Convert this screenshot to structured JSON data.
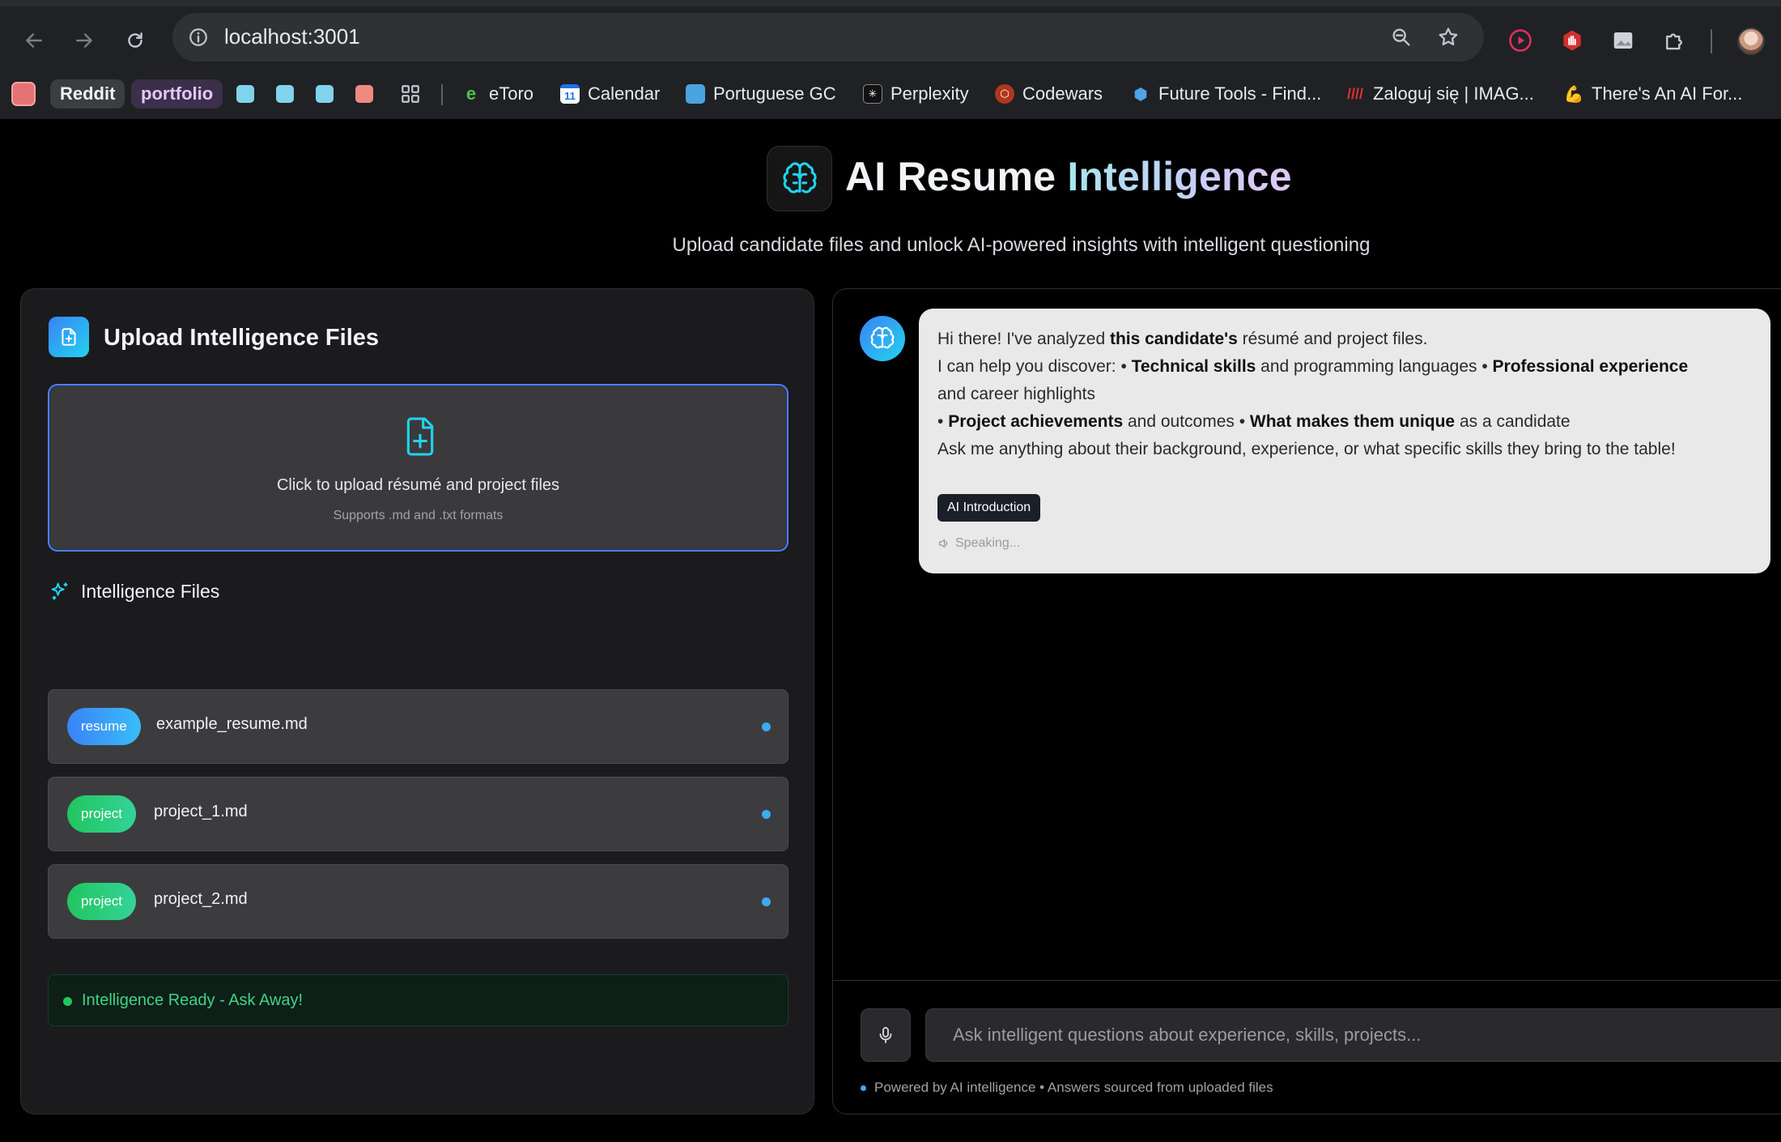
{
  "browser": {
    "url": "localhost:3001",
    "bookmarks": [
      {
        "label": "Reddit"
      },
      {
        "label": "portfolio"
      },
      {
        "label": "eToro"
      },
      {
        "label": "Calendar"
      },
      {
        "label": "Portuguese GC"
      },
      {
        "label": "Perplexity"
      },
      {
        "label": "Codewars"
      },
      {
        "label": "Future Tools - Find..."
      },
      {
        "label": "Zaloguj się | IMAG..."
      },
      {
        "label": "There's An AI For..."
      }
    ],
    "calendar_day": "11"
  },
  "hero": {
    "title_part1": "AI Resume",
    "title_part2": "Intelligence",
    "subtitle": "Upload candidate files and unlock AI-powered insights with intelligent questioning"
  },
  "upload": {
    "title": "Upload Intelligence Files",
    "dropzone_text": "Click to upload résumé and project files",
    "dropzone_sub": "Supports .md and .txt formats",
    "files_title": "Intelligence Files",
    "files": [
      {
        "tag": "resume",
        "name": "example_resume.md"
      },
      {
        "tag": "project",
        "name": "project_1.md"
      },
      {
        "tag": "project",
        "name": "project_2.md"
      }
    ],
    "status": "Intelligence Ready - Ask Away!"
  },
  "chat": {
    "message": {
      "l1a": "Hi there! I've analyzed ",
      "l1b": "this candidate's",
      "l1c": " résumé and project files.",
      "l2a": "I can help you discover: • ",
      "l2b": "Technical skills",
      "l2c": " and programming languages • ",
      "l2d": "Professional experience",
      "l3": "and career highlights",
      "l4a": "• ",
      "l4b": "Project achievements",
      "l4c": " and outcomes • ",
      "l4d": "What makes them unique",
      "l4e": " as a candidate",
      "l5": "Ask me anything about their background, experience, or what specific skills they bring to the table!"
    },
    "message_badge": "AI Introduction",
    "speaking": "Speaking...",
    "input_placeholder": "Ask intelligent questions about experience, skills, projects...",
    "footer": "Powered by AI intelligence • Answers sourced from uploaded files"
  },
  "colors": {
    "accent_blue": "#3b82f6",
    "accent_cyan": "#22d3ee",
    "project_green": "#22c55e",
    "ready_green": "#3ed487"
  },
  "icons": [
    "back-icon",
    "forward-icon",
    "reload-icon",
    "site-info-icon",
    "zoom-icon",
    "star-icon",
    "brain-icon",
    "file-plus-icon",
    "sparkles-icon",
    "microphone-icon",
    "speaker-icon"
  ]
}
